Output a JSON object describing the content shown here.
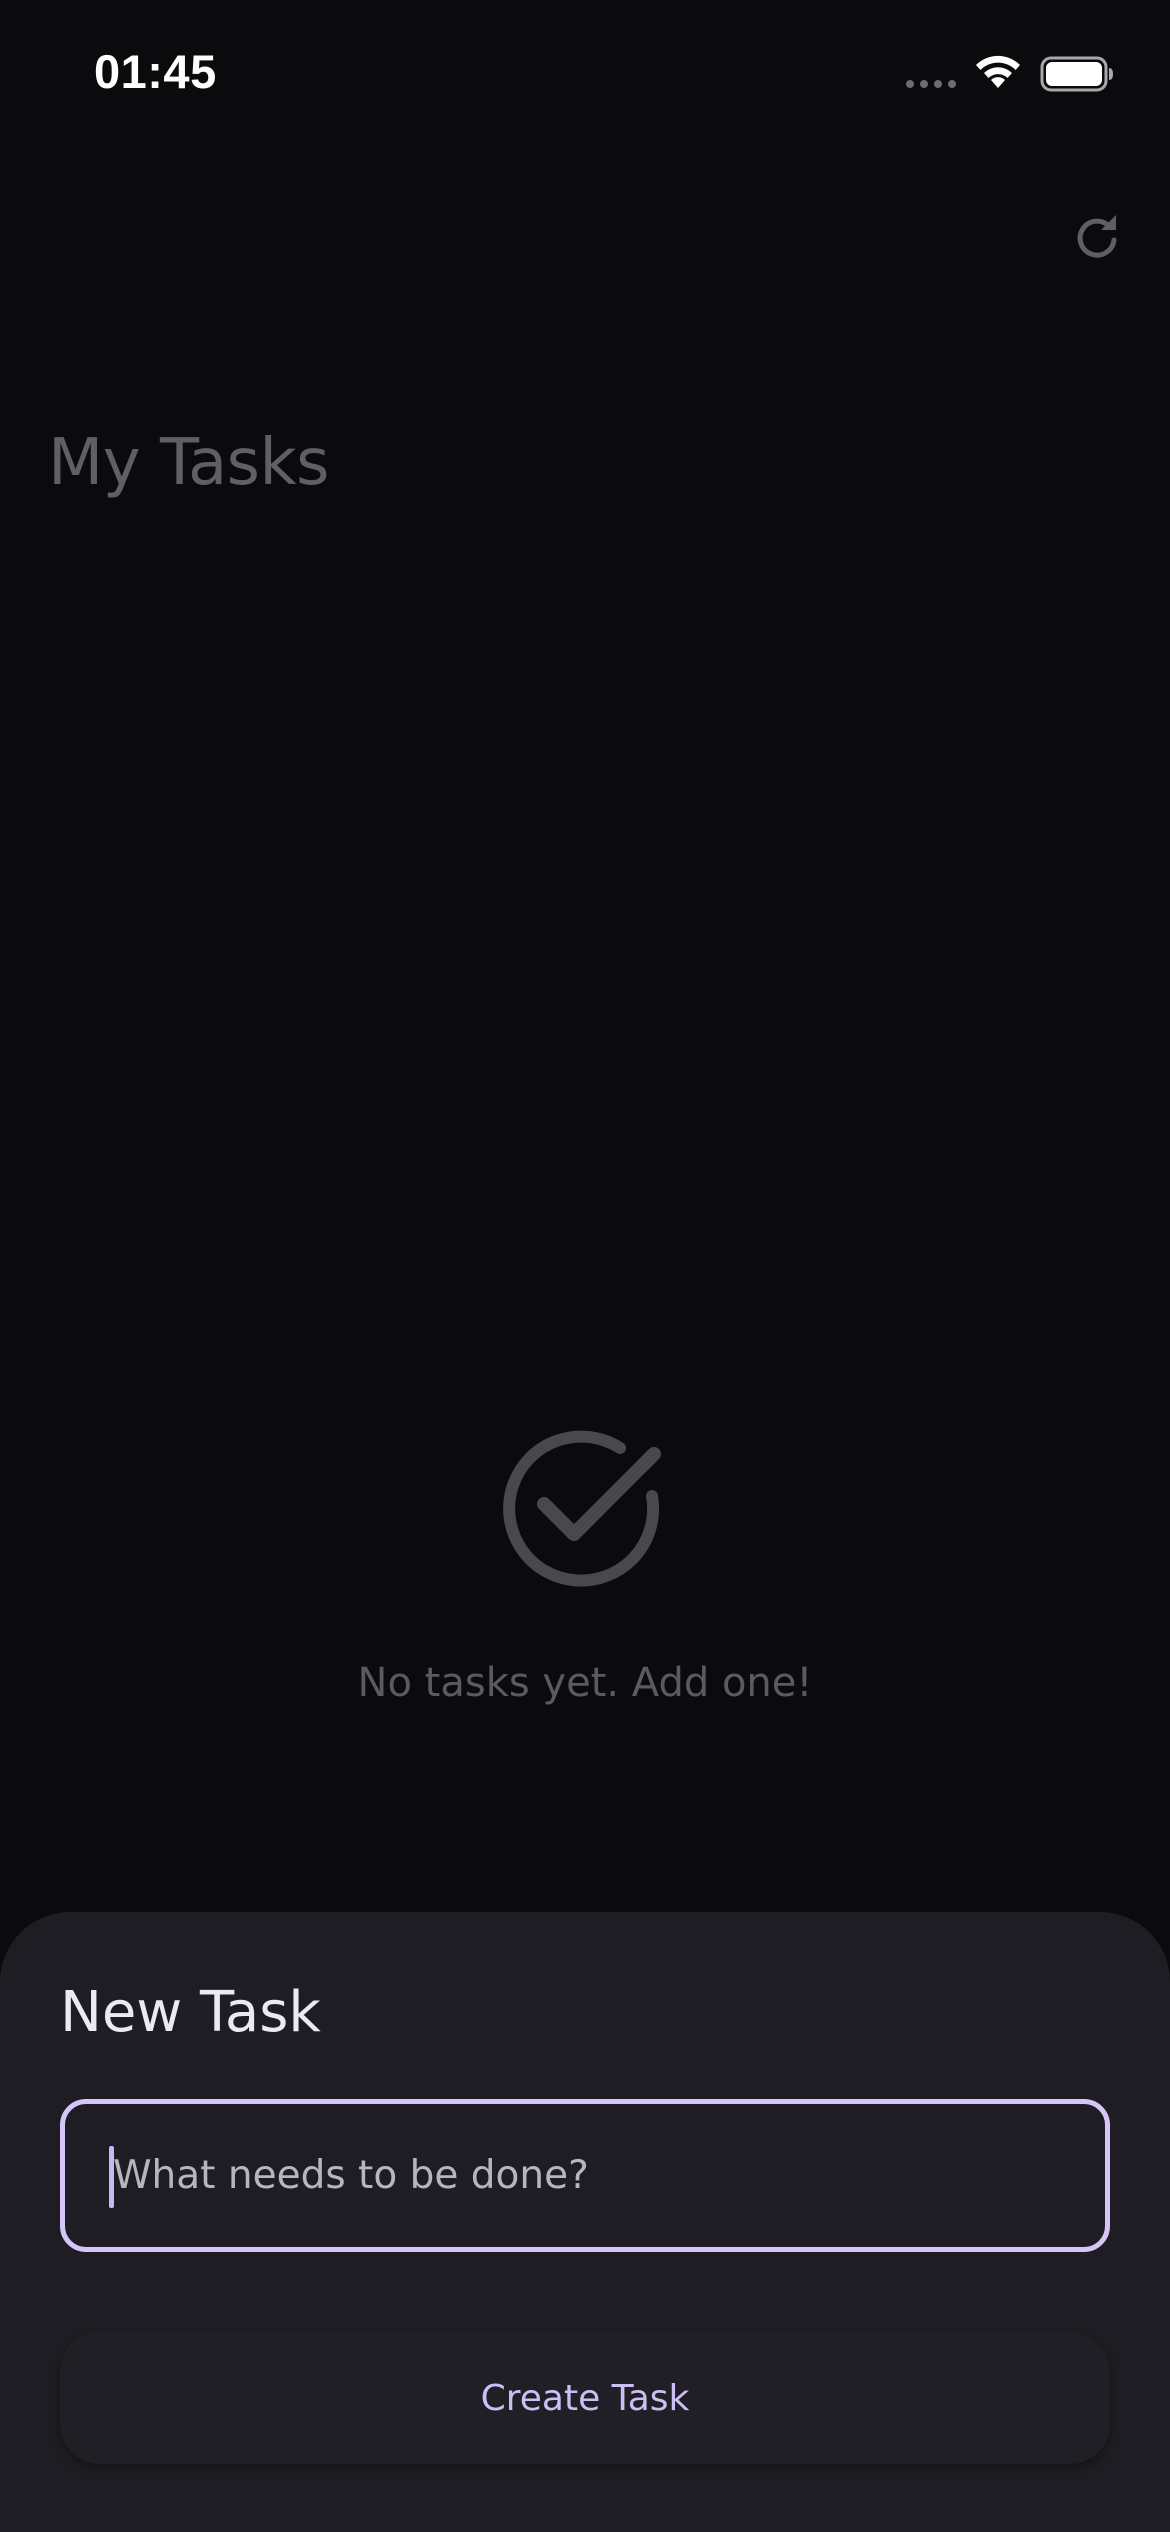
{
  "status_bar": {
    "time": "01:45"
  },
  "header": {
    "title": "My Tasks",
    "refresh_icon": "refresh-icon"
  },
  "empty_state": {
    "icon": "check-circle-icon",
    "message": "No tasks yet. Add one!"
  },
  "new_task_sheet": {
    "title": "New Task",
    "input": {
      "value": "",
      "placeholder": "What needs to be done?"
    },
    "create_label": "Create Task"
  },
  "colors": {
    "background": "#0b0b0d",
    "sheet": "#1e1d23",
    "accent": "#d6c6f7",
    "button_text": "#cdbef5",
    "muted": "#5f5f64"
  }
}
